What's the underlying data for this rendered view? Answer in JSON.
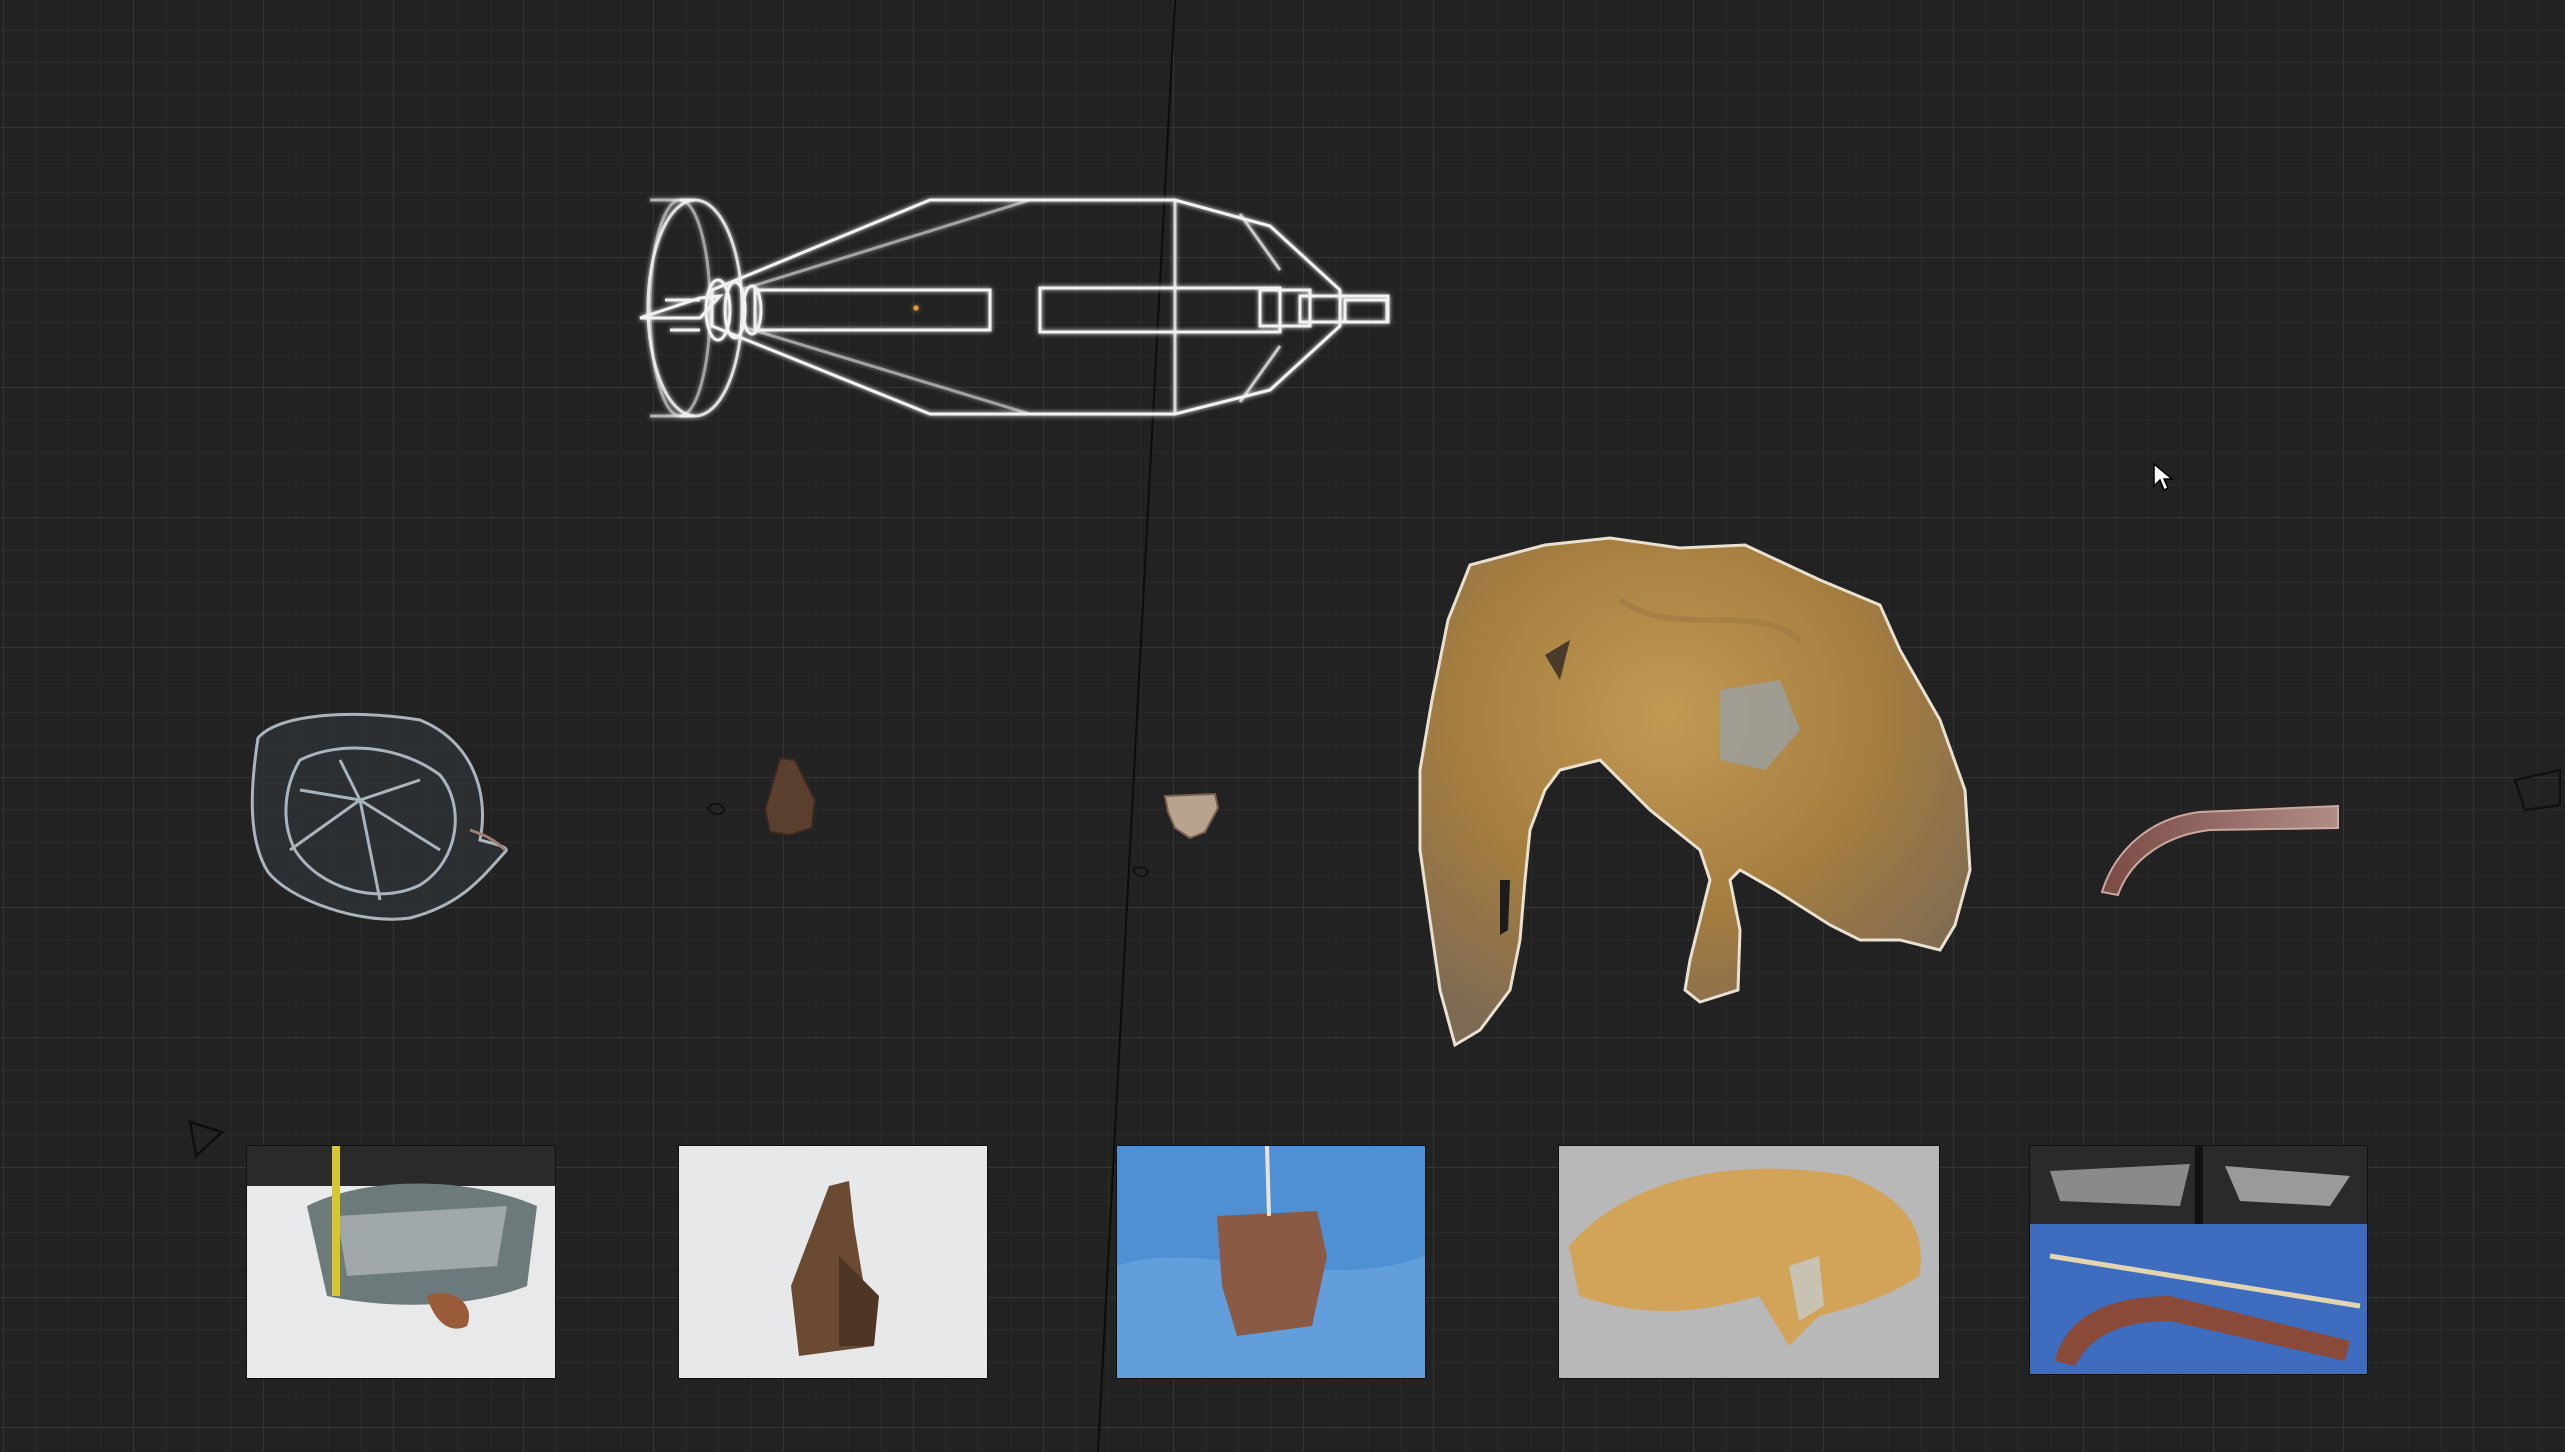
{
  "viewport": {
    "background": "#222222",
    "grid_color": "#343434",
    "wire_color": "#ffffff"
  },
  "icons": {
    "cursor": "mouse-pointer-icon",
    "camera_left": "camera-icon",
    "camera_right": "camera-icon"
  },
  "models": [
    "bomb-wireframe",
    "fragment-ring",
    "fragment-shard-small",
    "fragment-stub-small",
    "fragment-plate-large",
    "fragment-rail"
  ],
  "reference_photos": [
    "photo-ring",
    "photo-shard",
    "photo-stub",
    "photo-plate",
    "photo-rail"
  ]
}
